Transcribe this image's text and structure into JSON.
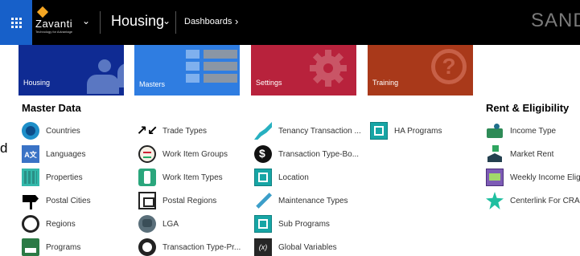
{
  "topbar": {
    "logo_word": "Zavanti",
    "logo_tagline": "Technology for Advantage",
    "area": "Housing",
    "breadcrumb": "Dashboards",
    "environment": "SAND"
  },
  "tiles": [
    {
      "label": "Housing",
      "color": "#0f2b93"
    },
    {
      "label": "Masters",
      "color": "#2f7de1"
    },
    {
      "label": "Settings",
      "color": "#b8223c"
    },
    {
      "label": "Training",
      "color": "#a9391a"
    }
  ],
  "side_fragment": "d",
  "sections": {
    "master_data": {
      "title": "Master Data",
      "col1": [
        "Countries",
        "Languages",
        "Properties",
        "Postal Cities",
        "Regions",
        "Programs"
      ],
      "col2": [
        "Trade Types",
        "Work Item Groups",
        "Work Item Types",
        "Postal Regions",
        "LGA",
        "Transaction Type-Pr..."
      ],
      "col3": [
        "Tenancy Transaction ...",
        "Transaction Type-Bo...",
        "Location",
        "Maintenance Types",
        "Sub Programs",
        "Global Variables"
      ],
      "col4": [
        "HA Programs"
      ]
    },
    "rent": {
      "title": "Rent & Eligibility",
      "items": [
        "Income Type",
        "Market Rent",
        "Weekly Income Elig",
        "Centerlink For CRA"
      ]
    }
  },
  "icons": {
    "col1": [
      "globe-icon",
      "language-icon",
      "properties-icon",
      "signpost-icon",
      "regions-icon",
      "programs-icon"
    ],
    "col2": [
      "arrows-icon",
      "faces-icon",
      "phone-icon",
      "postbox-icon",
      "lga-icon",
      "transaction-program-icon"
    ],
    "col3": [
      "tenancy-icon",
      "money-icon",
      "location-icon",
      "wrench-icon",
      "sub-programs-icon",
      "variable-icon"
    ],
    "col4": [
      "ha-programs-icon"
    ],
    "rent": [
      "income-icon",
      "market-icon",
      "weekly-income-icon",
      "centerlink-icon"
    ]
  }
}
